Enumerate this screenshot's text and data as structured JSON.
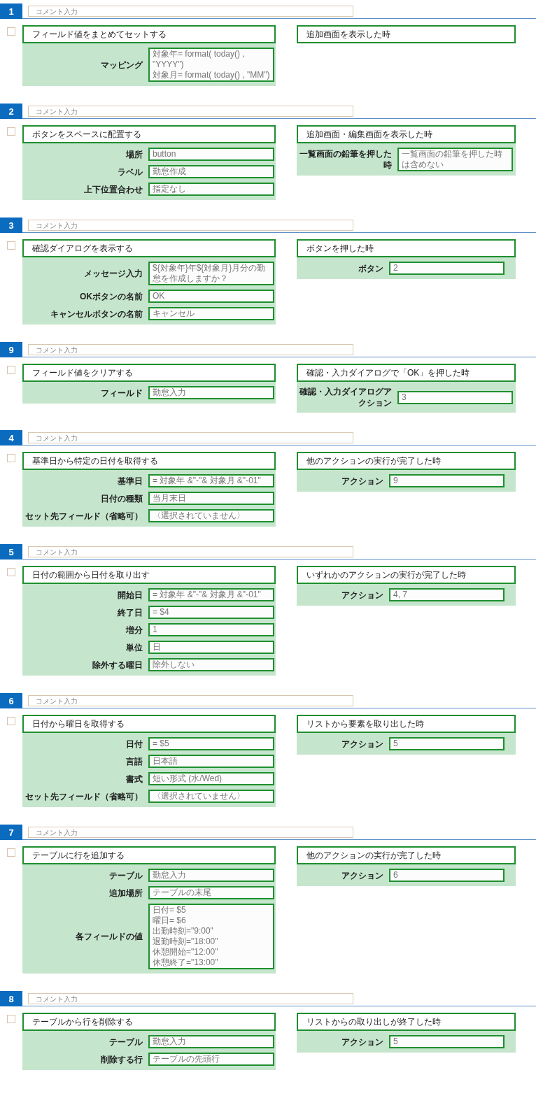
{
  "sections": [
    {
      "number": "1",
      "comment": {
        "placeholder": "コメント入力"
      },
      "checked": false,
      "action": {
        "title": "フィールド値をまとめてセットする",
        "params": [
          {
            "label": "マッピング",
            "value": "対象年= format( today() , \"YYYY\")\n対象月= format( today() , \"MM\")"
          }
        ]
      },
      "trigger": {
        "title": "追加画面を表示した時"
      }
    },
    {
      "number": "2",
      "comment": {
        "placeholder": "コメント入力"
      },
      "checked": false,
      "action": {
        "title": "ボタンをスペースに配置する",
        "params": [
          {
            "label": "場所",
            "value": "button"
          },
          {
            "label": "ラベル",
            "value": "勤怠作成"
          },
          {
            "label": "上下位置合わせ",
            "value": "指定なし"
          }
        ]
      },
      "trigger": {
        "title": "追加画面・編集画面を表示した時",
        "params": [
          {
            "label": "一覧画面の鉛筆を押した時",
            "value": "一覧画面の鉛筆を押した時は含めない"
          }
        ]
      }
    },
    {
      "number": "3",
      "comment": {
        "placeholder": "コメント入力"
      },
      "checked": false,
      "action": {
        "title": "確認ダイアログを表示する",
        "params": [
          {
            "label": "メッセージ入力",
            "value": "${対象年}年${対象月}月分の勤怠を作成しますか？"
          },
          {
            "label": "OKボタンの名前",
            "value": "OK"
          },
          {
            "label": "キャンセルボタンの名前",
            "value": "キャンセル"
          }
        ]
      },
      "trigger": {
        "title": "ボタンを押した時",
        "params": [
          {
            "label": "ボタン",
            "value": "2"
          }
        ]
      }
    },
    {
      "number": "9",
      "comment": {
        "placeholder": "コメント入力"
      },
      "checked": false,
      "action": {
        "title": "フィールド値をクリアする",
        "params": [
          {
            "label": "フィールド",
            "value": "勤怠入力"
          }
        ]
      },
      "trigger": {
        "title": "確認・入力ダイアログで「OK」を押した時",
        "params": [
          {
            "label": "確認・入力ダイアログアクション",
            "value": "3"
          }
        ]
      }
    },
    {
      "number": "4",
      "comment": {
        "placeholder": "コメント入力"
      },
      "checked": false,
      "action": {
        "title": "基準日から特定の日付を取得する",
        "params": [
          {
            "label": "基準日",
            "value": "= 対象年 &\"-\"& 対象月 &\"-01\""
          },
          {
            "label": "日付の種類",
            "value": "当月末日"
          },
          {
            "label": "セット先フィールド（省略可）",
            "value": "〈選択されていません〉"
          }
        ]
      },
      "trigger": {
        "title": "他のアクションの実行が完了した時",
        "params": [
          {
            "label": "アクション",
            "value": "9"
          }
        ]
      }
    },
    {
      "number": "5",
      "comment": {
        "placeholder": "コメント入力"
      },
      "checked": false,
      "action": {
        "title": "日付の範囲から日付を取り出す",
        "params": [
          {
            "label": "開始日",
            "value": "= 対象年 &\"-\"& 対象月 &\"-01\""
          },
          {
            "label": "終了日",
            "value": "= $4"
          },
          {
            "label": "増分",
            "value": "1"
          },
          {
            "label": "単位",
            "value": "日"
          },
          {
            "label": "除外する曜日",
            "value": "除外しない"
          }
        ]
      },
      "trigger": {
        "title": "いずれかのアクションの実行が完了した時",
        "params": [
          {
            "label": "アクション",
            "value": "4, 7"
          }
        ]
      }
    },
    {
      "number": "6",
      "comment": {
        "placeholder": "コメント入力"
      },
      "checked": false,
      "action": {
        "title": "日付から曜日を取得する",
        "params": [
          {
            "label": "日付",
            "value": "= $5"
          },
          {
            "label": "言語",
            "value": "日本語"
          },
          {
            "label": "書式",
            "value": "短い形式 (水/Wed)"
          },
          {
            "label": "セット先フィールド（省略可）",
            "value": "〈選択されていません〉"
          }
        ]
      },
      "trigger": {
        "title": "リストから要素を取り出した時",
        "params": [
          {
            "label": "アクション",
            "value": "5"
          }
        ]
      }
    },
    {
      "number": "7",
      "comment": {
        "placeholder": "コメント入力"
      },
      "checked": false,
      "action": {
        "title": "テーブルに行を追加する",
        "params": [
          {
            "label": "テーブル",
            "value": "勤怠入力"
          },
          {
            "label": "追加場所",
            "value": "テーブルの末尾"
          },
          {
            "label": "各フィールドの値",
            "value": "日付= $5\n曜日= $6\n出勤時刻=\"9:00\"\n退勤時刻=\"18:00\"\n休憩開始=\"12:00\"\n休憩終了=\"13:00\""
          }
        ]
      },
      "trigger": {
        "title": "他のアクションの実行が完了した時",
        "params": [
          {
            "label": "アクション",
            "value": "6"
          }
        ]
      }
    },
    {
      "number": "8",
      "comment": {
        "placeholder": "コメント入力"
      },
      "checked": false,
      "action": {
        "title": "テーブルから行を削除する",
        "params": [
          {
            "label": "テーブル",
            "value": "勤怠入力"
          },
          {
            "label": "削除する行",
            "value": "テーブルの先頭行"
          }
        ]
      },
      "trigger": {
        "title": "リストからの取り出しが終了した時",
        "params": [
          {
            "label": "アクション",
            "value": "5"
          }
        ]
      }
    }
  ]
}
